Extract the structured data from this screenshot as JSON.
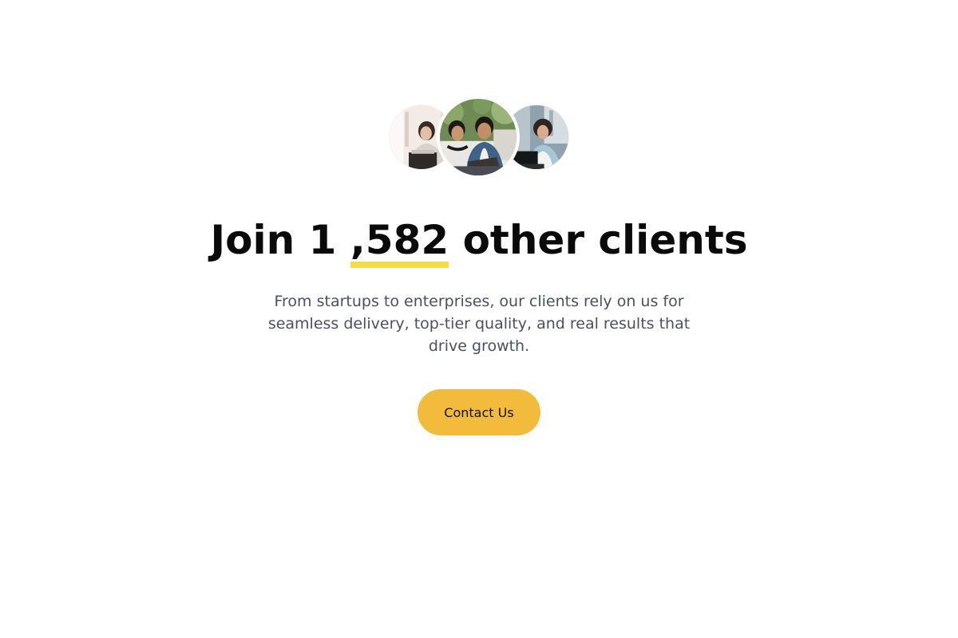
{
  "hero": {
    "avatars": [
      {
        "name": "client-avatar-left-photo"
      },
      {
        "name": "client-avatar-center-photo"
      },
      {
        "name": "client-avatar-right-photo"
      }
    ],
    "headline_prefix": "Join 1 ",
    "headline_count": ",582",
    "headline_suffix": " other clients",
    "subtitle": "From startups to enterprises, our clients rely on us for seamless delivery, top-tier quality, and real results that drive growth.",
    "cta_label": "Contact Us"
  },
  "colors": {
    "accent_underline": "#f5dc45",
    "cta_background": "#f2bb3c",
    "headline_text": "#0a0a0a",
    "subtitle_text": "#4b5060"
  }
}
